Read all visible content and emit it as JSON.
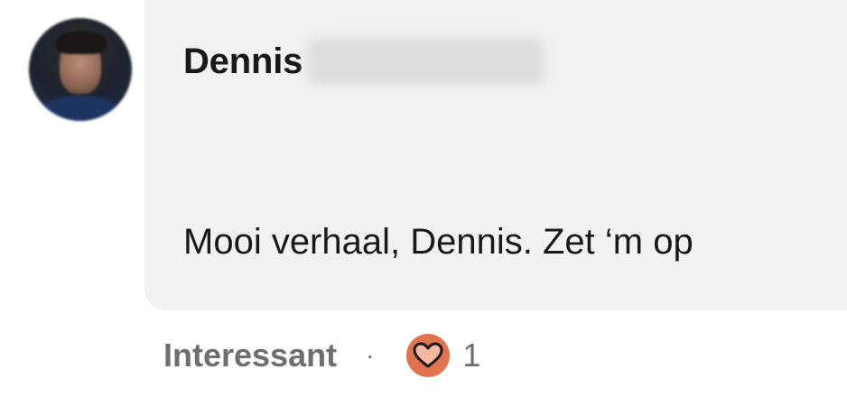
{
  "comment": {
    "author_first_name": "Dennis",
    "author_rest_name_blurred": true,
    "message": "Mooi verhaal, Dennis. Zet ‘m op",
    "react_label": "Interessant",
    "separator": "·",
    "reaction_count": "1",
    "reaction_icon": "heart-icon"
  },
  "colors": {
    "bubble_background": "#f2f2f2",
    "text_primary": "#191919",
    "text_secondary": "#6e6e6e",
    "reaction_accent": "#e2734f"
  }
}
